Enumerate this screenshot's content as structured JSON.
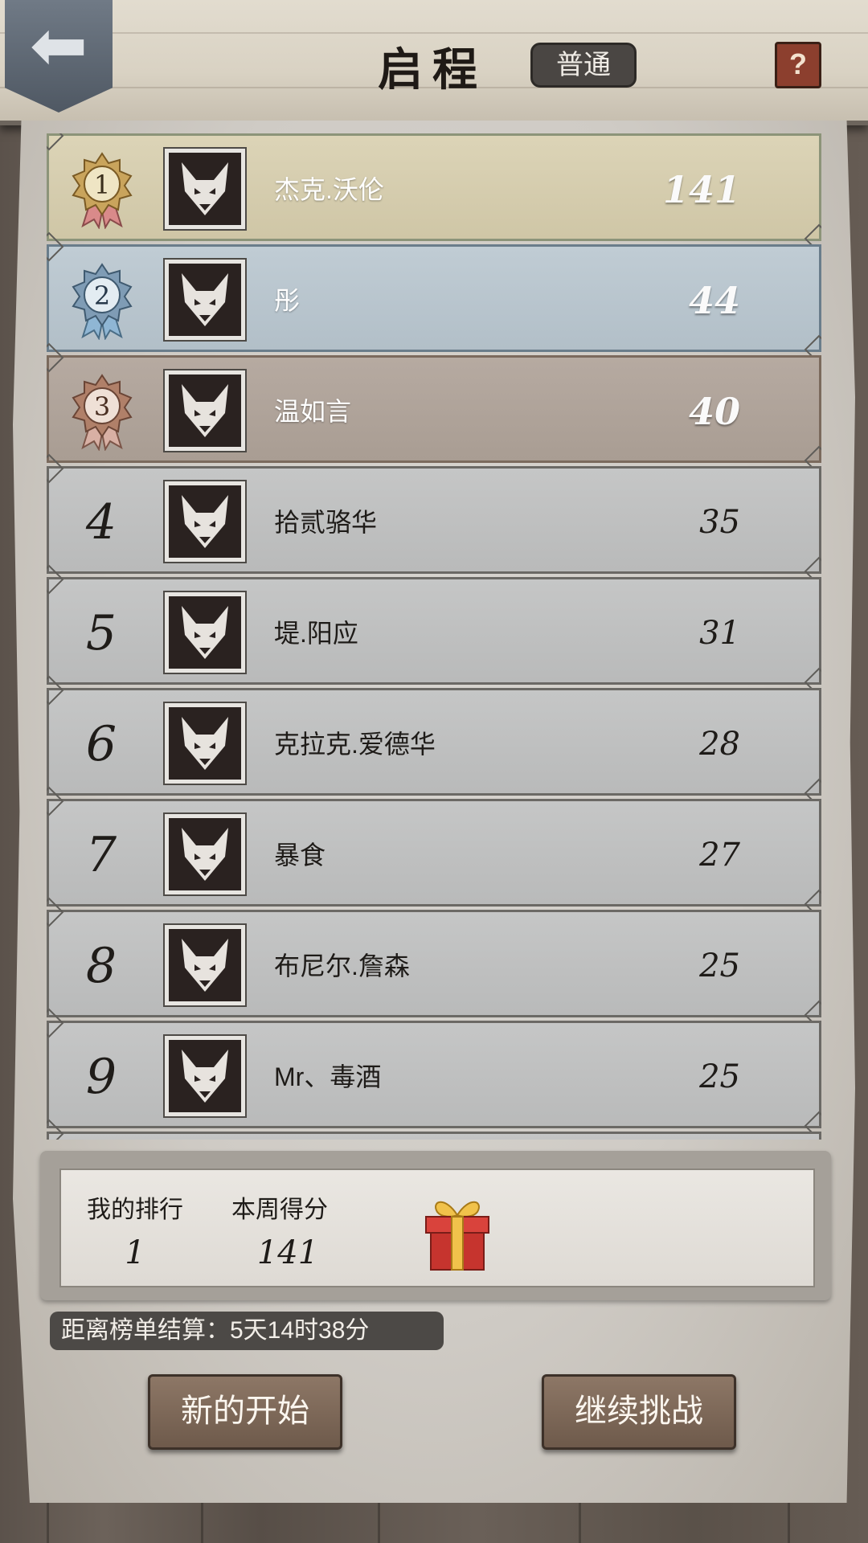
{
  "header": {
    "title": "启程",
    "mode": "普通",
    "help": "?"
  },
  "leaderboard": [
    {
      "rank": "1",
      "name": "杰克.沃伦",
      "score": "141",
      "medal": "gold"
    },
    {
      "rank": "2",
      "name": "彤",
      "score": "44",
      "medal": "silver"
    },
    {
      "rank": "3",
      "name": "温如言",
      "score": "40",
      "medal": "bronze"
    },
    {
      "rank": "4",
      "name": "拾贰骆华",
      "score": "35"
    },
    {
      "rank": "5",
      "name": "堤.阳应",
      "score": "31"
    },
    {
      "rank": "6",
      "name": "克拉克.爱德华",
      "score": "28"
    },
    {
      "rank": "7",
      "name": "暴食",
      "score": "27"
    },
    {
      "rank": "8",
      "name": "布尼尔.詹森",
      "score": "25"
    },
    {
      "rank": "9",
      "name": "Mr、毒酒",
      "score": "25"
    }
  ],
  "my_stats": {
    "rank_label": "我的排行",
    "rank_value": "1",
    "score_label": "本周得分",
    "score_value": "141"
  },
  "countdown": "距离榜单结算：5天14时38分",
  "buttons": {
    "restart": "新的开始",
    "continue": "继续挑战"
  },
  "colors": {
    "gold_row": "#dcd4b7",
    "silver_row": "#c0ccd4",
    "bronze_row": "#b6aaa1",
    "plain_row": "#c5c6c6"
  }
}
